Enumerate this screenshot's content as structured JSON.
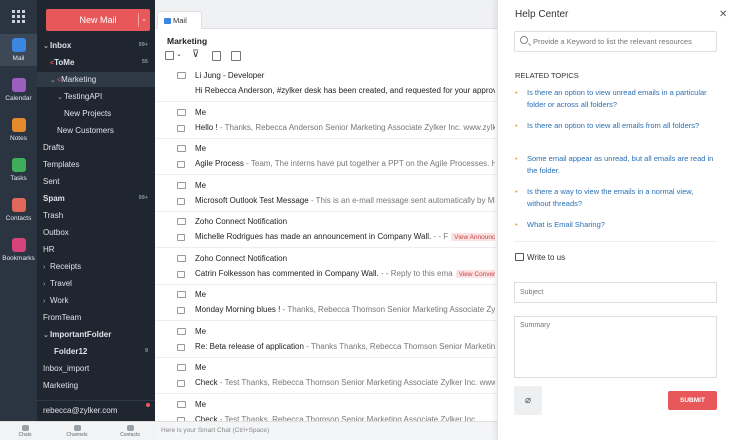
{
  "apps": [
    {
      "label": "Mail",
      "color": "#3a86e0"
    },
    {
      "label": "Calendar",
      "color": "#9b5fc0"
    },
    {
      "label": "Notes",
      "color": "#e58a2e"
    },
    {
      "label": "Tasks",
      "color": "#3fae5a"
    },
    {
      "label": "Contacts",
      "color": "#e0675a"
    },
    {
      "label": "Bookmarks",
      "color": "#d4437a"
    }
  ],
  "new_mail_label": "New Mail",
  "folders": [
    {
      "label": "Inbox",
      "count": "99+",
      "arrow": "⌄",
      "bold": true
    },
    {
      "label": "ToMe",
      "count": "55",
      "tag": "<",
      "bold": true
    },
    {
      "label": "Marketing",
      "arrow": "⌄",
      "tag": "<",
      "selected": true
    },
    {
      "label": "TestingAPI",
      "arrow": "⌄"
    },
    {
      "label": "New Projects"
    },
    {
      "label": "New Customers"
    },
    {
      "label": "Drafts"
    },
    {
      "label": "Templates"
    },
    {
      "label": "Sent"
    },
    {
      "label": "Spam",
      "count": "99+",
      "bold": true
    },
    {
      "label": "Trash"
    },
    {
      "label": "Outbox"
    },
    {
      "label": "HR"
    },
    {
      "label": "Receipts",
      "arrow": "›"
    },
    {
      "label": "Travel",
      "arrow": "›"
    },
    {
      "label": "Work",
      "arrow": "›"
    },
    {
      "label": "FromTeam"
    },
    {
      "label": "ImportantFolder",
      "arrow": "⌄",
      "bold": true
    },
    {
      "label": "Folder12",
      "count": "9",
      "bold": true
    },
    {
      "label": "Inbox_import"
    },
    {
      "label": "Marketing"
    }
  ],
  "account": "rebecca@zylker.com",
  "bottom_bar": [
    "Chats",
    "Channels",
    "Contacts"
  ],
  "tab_label": "Mail",
  "folder_title": "Marketing",
  "mails": [
    {
      "from": "Li Jung - Developer",
      "subject": "Hi Rebecca Anderson, #zylker desk has been created, and requested for your approval",
      "preview": ""
    },
    {
      "from": "Me",
      "subject": "Hello !",
      "preview": " - Thanks, Rebecca Anderson Senior Marketing Associate Zylker Inc. www.zylker.com"
    },
    {
      "from": "Me",
      "subject": "Agile Process",
      "preview": " - Team, The interns have put together a PPT on the Agile Processes. Have a look"
    },
    {
      "from": "Me",
      "subject": "Microsoft Outlook Test Message",
      "preview": " - This is an e-mail message sent automatically by Microsoft"
    },
    {
      "from": "Zoho Connect Notification",
      "subject": "Michelle Rodrigues has made an announcement in Company Wall.",
      "preview": " - - F",
      "pill": "View Announcement"
    },
    {
      "from": "Zoho Connect Notification",
      "subject": "Catrin Folkesson has commented in Company Wall.",
      "preview": " - - Reply to this ema",
      "pill": "View Conversation"
    },
    {
      "from": "Me",
      "subject": "Monday Morning blues !",
      "preview": " - Thanks, Rebecca Thomson Senior Marketing Associate Zylker Inc."
    },
    {
      "from": "Me",
      "subject": "Re: Beta release of application",
      "preview": " - Thanks Thanks, Rebecca Thomson Senior Marketing Associate"
    },
    {
      "from": "Me",
      "subject": "Check",
      "preview": " - Test Thanks, Rebecca Thomson Senior Marketing Associate Zylker Inc. www.zylker.com"
    },
    {
      "from": "Me",
      "subject": "Check",
      "preview": " - Test Thanks, Rebecca Thomson Senior Marketing Associate Zylker Inc."
    }
  ],
  "smart_chat_placeholder": "Here is your Smart Chat (Ctrl+Space)",
  "help": {
    "title": "Help Center",
    "search_placeholder": "Provide a Keyword to list the relevant resources",
    "related_title": "RELATED TOPICS",
    "topics": [
      "Is there an option to view unread emails in a particular folder or across all folders?",
      "Is there an option to view all emails from all folders?",
      "Some email appear as unread, but all emails are read in the folder.",
      "Is there a way to view the emails in a normal view, without threads?",
      "What is Email Sharing?"
    ],
    "write_title": "Write to us",
    "subject_placeholder": "Subject",
    "summary_placeholder": "Summary",
    "submit_label": "SUBMIT"
  }
}
